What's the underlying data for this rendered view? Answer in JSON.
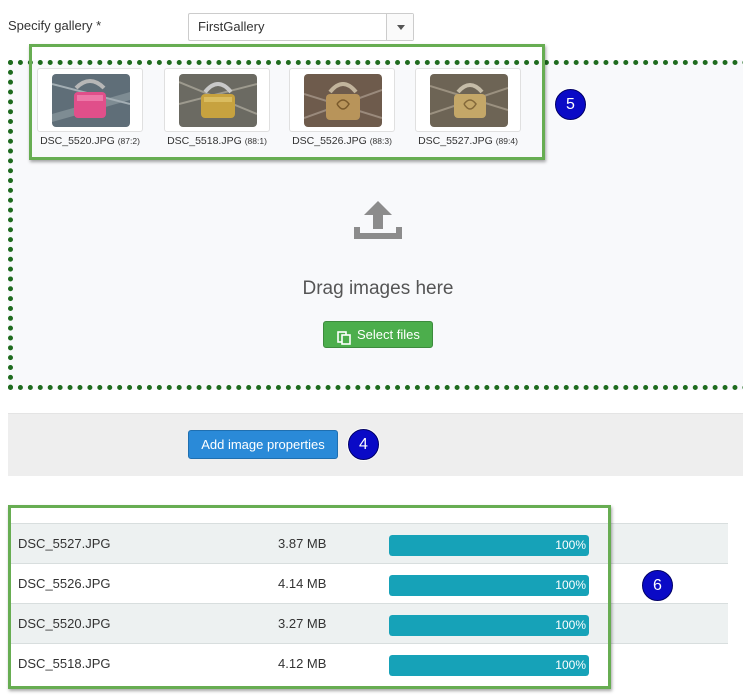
{
  "gallery": {
    "label": "Specify gallery *",
    "selected": "FirstGallery"
  },
  "dropzone": {
    "thumbnails": [
      {
        "file": "DSC_5520.JPG",
        "ratio": "(87:2)"
      },
      {
        "file": "DSC_5518.JPG",
        "ratio": "(88:1)"
      },
      {
        "file": "DSC_5526.JPG",
        "ratio": "(88:3)"
      },
      {
        "file": "DSC_5527.JPG",
        "ratio": "(89:4)"
      }
    ],
    "drag_text": "Drag images here",
    "select_files_label": "Select files",
    "icons": {
      "upload": "upload-icon",
      "copy": "copy-icon"
    }
  },
  "properties": {
    "add_button_label": "Add image properties"
  },
  "badges": {
    "step5": "5",
    "step4": "4",
    "step6": "6"
  },
  "files": [
    {
      "name": "DSC_5527.JPG",
      "size": "3.87 MB",
      "progress": 100,
      "progress_label": "100%"
    },
    {
      "name": "DSC_5526.JPG",
      "size": "4.14 MB",
      "progress": 100,
      "progress_label": "100%"
    },
    {
      "name": "DSC_5520.JPG",
      "size": "3.27 MB",
      "progress": 100,
      "progress_label": "100%"
    },
    {
      "name": "DSC_5518.JPG",
      "size": "4.12 MB",
      "progress": 100,
      "progress_label": "100%"
    }
  ],
  "colors": {
    "badge": "#0a0ac6",
    "highlight_outline": "#67ad52",
    "dropzone_border": "#1e6b1e",
    "progress_fill": "#16a2b8",
    "select_button": "#4cae4c",
    "primary_button": "#2a8ad8"
  }
}
